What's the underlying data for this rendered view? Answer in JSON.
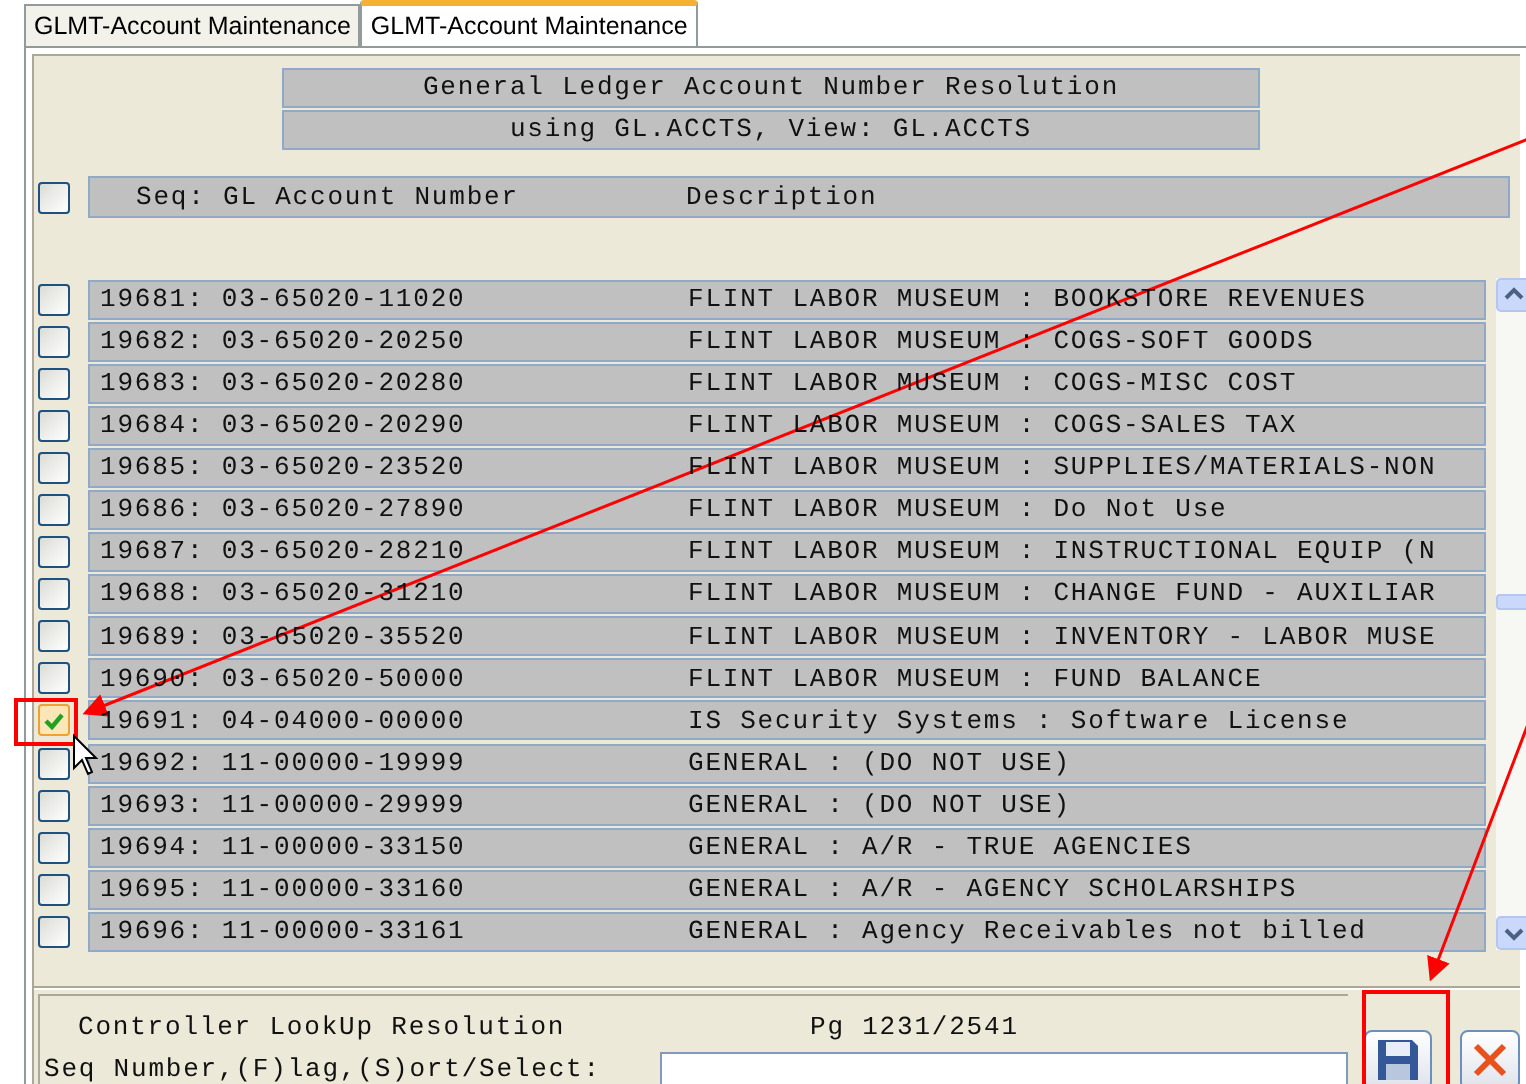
{
  "tabs": [
    {
      "label": "GLMT-Account Maintenance",
      "selected": false
    },
    {
      "label": "GLMT-Account Maintenance",
      "selected": true
    }
  ],
  "title_lines": [
    "General Ledger Account Number Resolution",
    "using GL.ACCTS, View: GL.ACCTS"
  ],
  "header": {
    "checked": false,
    "account_column": "Seq: GL Account Number",
    "description_column": "Description"
  },
  "rows": [
    {
      "account": "19681: 03-65020-11020",
      "description": "FLINT LABOR MUSEUM : BOOKSTORE REVENUES",
      "checked": false
    },
    {
      "account": "19682: 03-65020-20250",
      "description": "FLINT LABOR MUSEUM : COGS-SOFT GOODS",
      "checked": false
    },
    {
      "account": "19683: 03-65020-20280",
      "description": "FLINT LABOR MUSEUM : COGS-MISC COST",
      "checked": false
    },
    {
      "account": "19684: 03-65020-20290",
      "description": "FLINT LABOR MUSEUM : COGS-SALES TAX",
      "checked": false
    },
    {
      "account": "19685: 03-65020-23520",
      "description": "FLINT LABOR MUSEUM : SUPPLIES/MATERIALS-NON",
      "checked": false
    },
    {
      "account": "19686: 03-65020-27890",
      "description": "FLINT LABOR MUSEUM : Do Not Use",
      "checked": false
    },
    {
      "account": "19687: 03-65020-28210",
      "description": "FLINT LABOR MUSEUM : INSTRUCTIONAL EQUIP (N",
      "checked": false
    },
    {
      "account": "19688: 03-65020-31210",
      "description": "FLINT LABOR MUSEUM : CHANGE FUND - AUXILIAR",
      "checked": false
    },
    {
      "account": "19689: 03-65020-35520",
      "description": "FLINT LABOR MUSEUM : INVENTORY - LABOR MUSE",
      "checked": false
    },
    {
      "account": "19690: 03-65020-50000",
      "description": "FLINT LABOR MUSEUM : FUND BALANCE",
      "checked": false
    },
    {
      "account": "19691: 04-04000-00000",
      "description": "IS Security Systems : Software License",
      "checked": true
    },
    {
      "account": "19692: 11-00000-19999",
      "description": "GENERAL : (DO NOT USE)",
      "checked": false
    },
    {
      "account": "19693: 11-00000-29999",
      "description": "GENERAL : (DO NOT USE)",
      "checked": false
    },
    {
      "account": "19694: 11-00000-33150",
      "description": "GENERAL : A/R - TRUE AGENCIES",
      "checked": false
    },
    {
      "account": "19695: 11-00000-33160",
      "description": "GENERAL : A/R - AGENCY SCHOLARSHIPS",
      "checked": false
    },
    {
      "account": "19696: 11-00000-33161",
      "description": "GENERAL : Agency Receivables not billed",
      "checked": false
    }
  ],
  "footer": {
    "title": "Controller LookUp Resolution",
    "page": "Pg 1231/2541",
    "prompt": "Seq Number,(F)lag,(S)ort/Select:"
  }
}
